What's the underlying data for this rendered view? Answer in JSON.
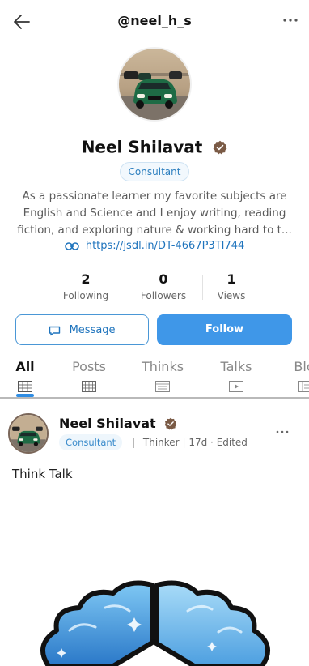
{
  "header": {
    "handle": "@neel_h_s",
    "back_icon": "arrow-left-icon",
    "more_icon": "more-horizontal-icon"
  },
  "profile": {
    "name": "Neel Shilavat",
    "verified_icon": "verified-badge-icon",
    "role": "Consultant",
    "bio_lines": [
      "As a passionate learner my favorite subjects are",
      "English and Science and I enjoy writing, reading",
      "fiction, and exploring nature & working hard to t..."
    ],
    "link": "https://jsdl.in/DT-4667P3TI744",
    "link_icon": "link-icon"
  },
  "stats": [
    {
      "value": "2",
      "label": "Following"
    },
    {
      "value": "0",
      "label": "Followers"
    },
    {
      "value": "1",
      "label": "Views"
    }
  ],
  "actions": {
    "message_label": "Message",
    "message_icon": "message-icon",
    "follow_label": "Follow"
  },
  "tabs": [
    {
      "label": "All",
      "active": true,
      "icon": "all-grid-icon"
    },
    {
      "label": "Posts",
      "active": false,
      "icon": "posts-grid-icon"
    },
    {
      "label": "Thinks",
      "active": false,
      "icon": "thinks-list-icon"
    },
    {
      "label": "Talks",
      "active": false,
      "icon": "talks-video-icon"
    },
    {
      "label": "Blo",
      "active": false,
      "icon": "blogs-icon"
    }
  ],
  "post": {
    "author": "Neel Shilavat",
    "role": "Consultant",
    "type": "Thinker",
    "time": "17d",
    "edited": "Edited",
    "separator": "|",
    "dot": "·",
    "title": "Think Talk",
    "more_icon": "more-horizontal-icon",
    "image_icon": "brain-logo-icon"
  },
  "colors": {
    "accent": "#3f97e8",
    "link": "#1f74bd",
    "verified": "#7a5a45",
    "pill_text": "#2d7fbf"
  }
}
